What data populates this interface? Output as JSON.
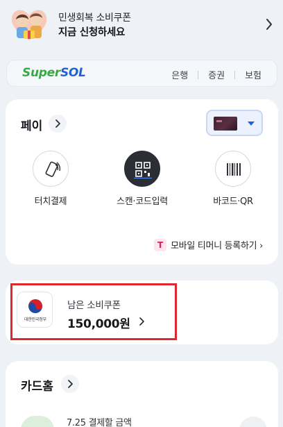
{
  "banner": {
    "line1": "민생회복 소비쿠폰",
    "line2": "지금 신청하세요"
  },
  "supersol": {
    "logo_part1": "Super",
    "logo_part2": "SOL",
    "nav": [
      "은행",
      "증권",
      "보험"
    ]
  },
  "pay": {
    "title": "페이",
    "actions": [
      {
        "label": "터치결제",
        "icon": "touch-pay-icon"
      },
      {
        "label": "스캔·코드입력",
        "icon": "qr-scan-icon"
      },
      {
        "label": "바코드·QR",
        "icon": "barcode-icon"
      }
    ],
    "tmoney_badge": "T",
    "tmoney_label": "모바일 티머니 등록하기 ›"
  },
  "coupon": {
    "emblem_text": "대한민국정부",
    "label": "남은 소비쿠폰",
    "amount": "150,000원"
  },
  "card_home": {
    "title": "카드홈",
    "subtitle": "7.25 결제할 금액"
  },
  "colors": {
    "brand_green": "#38a843",
    "brand_blue": "#1e62d6",
    "highlight_red": "#e0262f",
    "background": "#eef1f6"
  }
}
